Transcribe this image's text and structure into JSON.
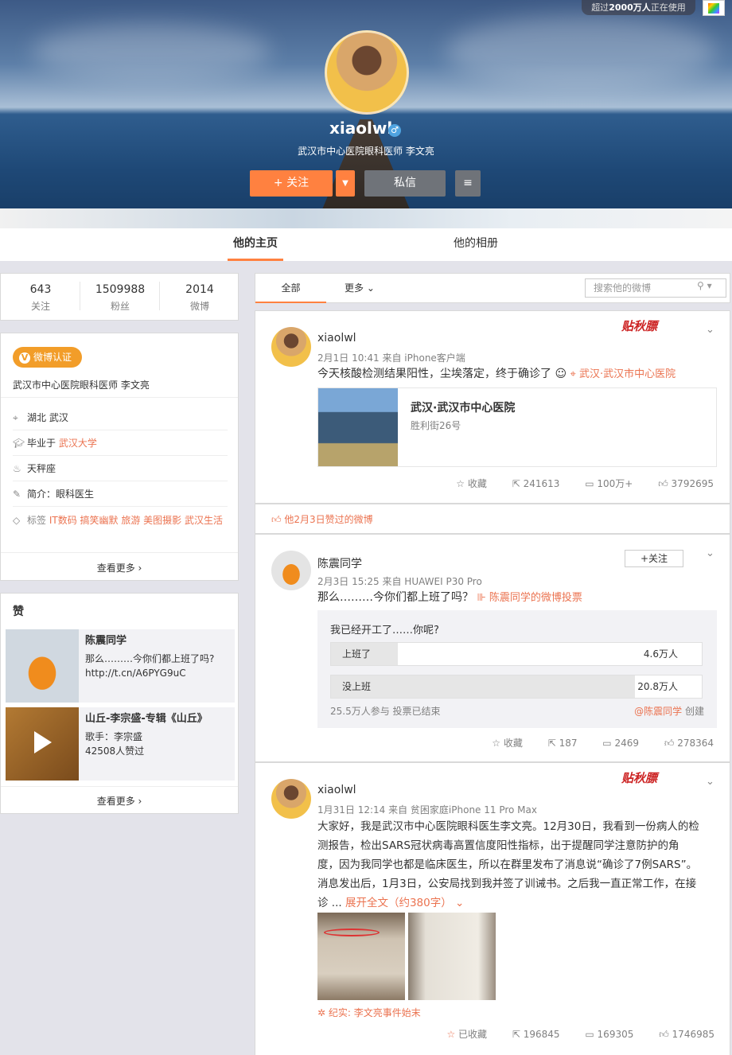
{
  "top_badge": {
    "prefix": "超过",
    "count": "2000万人",
    "suffix": "正在使用"
  },
  "profile": {
    "name": "xiaolwl",
    "gender_icon": "male-icon",
    "desc": "武汉市中心医院眼科医师 李文亮",
    "follow": "+ 关注",
    "message": "私信"
  },
  "tabs": [
    "他的主页",
    "他的相册"
  ],
  "stats": [
    {
      "num": "643",
      "label": "关注"
    },
    {
      "num": "1509988",
      "label": "粉丝"
    },
    {
      "num": "2014",
      "label": "微博"
    }
  ],
  "info": {
    "verify": "微博认证",
    "verify_text": "武汉市中心医院眼科医师 李文亮",
    "location": "湖北 武汉",
    "school_prefix": "毕业于 ",
    "school": "武汉大学",
    "sign": "天秤座",
    "intro_label": "简介：",
    "intro": "眼科医生",
    "tags_label": "标签 ",
    "tags": "IT数码 搞笑幽默 旅游 美图摄影 武汉生活",
    "more": "查看更多 ›"
  },
  "zan": {
    "title": "赞",
    "items": [
      {
        "title": "陈震同学",
        "line1": "那么………今你们都上班了吗?",
        "line2": "http://t.cn/A6PYG9uC"
      },
      {
        "title": "山丘-李宗盛-专辑《山丘》",
        "line1": "歌手：李宗盛",
        "line2": "42508人赞过"
      }
    ],
    "more": "查看更多 ›"
  },
  "feed_head": {
    "all": "全部",
    "more": "更多",
    "search_placeholder": "搜索他的微博"
  },
  "posts": [
    {
      "name": "xiaolwl",
      "meta": "2月1日 10:41 来自 iPhone客户端",
      "text": "今天核酸检测结果阳性，尘埃落定，终于确诊了",
      "location": "武汉·武汉市中心医院",
      "card_title": "武汉·武汉市中心医院",
      "card_sub": "胜利街26号",
      "stamp": "贴秋膘",
      "fav": "收藏",
      "repost": "241613",
      "comment": "100万+",
      "like": "3792695"
    },
    {
      "liked_note": "他2月3日赞过的微博"
    },
    {
      "name": "陈震同学",
      "meta": "2月3日 15:25 来自 HUAWEI P30 Pro",
      "text": "那么………今你们都上班了吗？",
      "vote_link": "陈震同学的微博投票",
      "follow": "+关注",
      "vote_q": "我已经开工了……你呢?",
      "options": [
        {
          "label": "上班了",
          "count": "4.6万人",
          "share": 0.18
        },
        {
          "label": "没上班",
          "count": "20.8万人",
          "share": 0.82
        }
      ],
      "vote_summary": "25.5万人参与 投票已结束",
      "creator": "@陈震同学",
      "creator_suffix": " 创建",
      "fav": "收藏",
      "repost": "187",
      "comment": "2469",
      "like": "278364"
    },
    {
      "name": "xiaolwl",
      "meta": "1月31日 12:14 来自 贫困家庭iPhone 11 Pro Max",
      "lines": [
        "大家好，我是武汉市中心医院眼科医生李文亮。12月30日，我看到一份病人的检",
        "测报告，检出SARS冠状病毒高置信度阳性指标，出于提醒同学注意防护的角",
        "度，因为我同学也都是临床医生，所以在群里发布了消息说“确诊了7例SARS”。",
        "消息发出后，1月3日，公安局找到我并签了训诫书。之后我一直正常工作，在接"
      ],
      "last_prefix": "诊 ... ",
      "expand": "展开全文（约380字）",
      "tag": "纪实: 李文亮事件始末",
      "stamp": "贴秋膘",
      "fav": "已收藏",
      "repost": "196845",
      "comment": "169305",
      "like": "1746985"
    }
  ],
  "colors": {
    "accent": "#ff8140",
    "link": "#eb7350"
  }
}
